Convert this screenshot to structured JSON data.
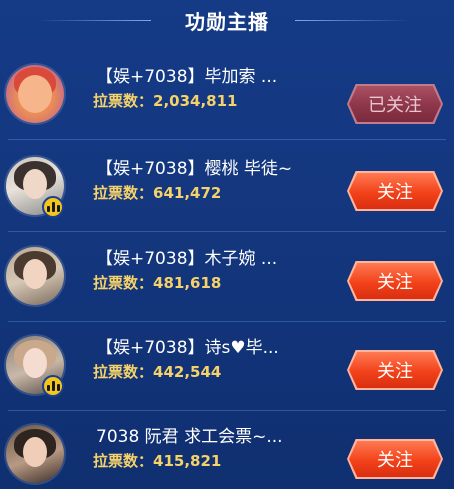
{
  "header": {
    "title": "功勋主播"
  },
  "colors": {
    "accent": "#f5d36a",
    "follow": "#f2421a",
    "followed": "#8e3649",
    "background": "#153a86"
  },
  "anchors": [
    {
      "name": "【娱+7038】毕加索 ...",
      "votes_label": "拉票数：",
      "votes": "2,034,811",
      "button": "已关注",
      "followed": true,
      "live": false
    },
    {
      "name": "【娱+7038】樱桃 毕徒~",
      "votes_label": "拉票数：",
      "votes": "641,472",
      "button": "关注",
      "followed": false,
      "live": true
    },
    {
      "name": "【娱+7038】木子婉 ...",
      "votes_label": "拉票数：",
      "votes": "481,618",
      "button": "关注",
      "followed": false,
      "live": false
    },
    {
      "name": "【娱+7038】诗s♥毕...",
      "votes_label": "拉票数：",
      "votes": "442,544",
      "button": "关注",
      "followed": false,
      "live": true
    },
    {
      "name": "7038 阮君 求工会票~...",
      "votes_label": "拉票数：",
      "votes": "415,821",
      "button": "关注",
      "followed": false,
      "live": false
    }
  ]
}
